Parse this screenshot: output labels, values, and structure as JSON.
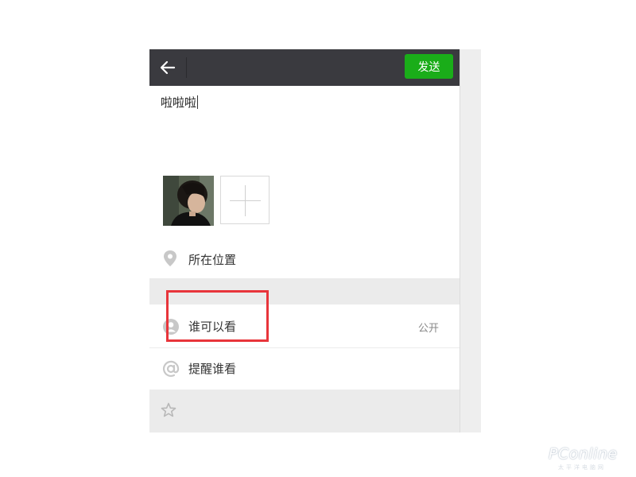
{
  "topbar": {
    "back_icon": "arrow-left-icon",
    "send_label": "发送",
    "send_color": "#1aad19",
    "bar_color": "#3a3a3f"
  },
  "compose": {
    "text": "啦啦啦"
  },
  "photos": {
    "photo_icon": "user-photo-thumbnail",
    "add_icon": "plus-icon"
  },
  "location": {
    "icon": "location-pin-icon",
    "label": "所在位置"
  },
  "visibility": {
    "icon": "person-icon",
    "label": "谁可以看",
    "value": "公开",
    "highlight_color": "#e8353b"
  },
  "mention": {
    "icon": "at-sign-icon",
    "label": "提醒谁看"
  },
  "footer": {
    "icon": "star-icon"
  },
  "watermark": {
    "text": "PConline",
    "sub": "太平洋电脑网"
  }
}
